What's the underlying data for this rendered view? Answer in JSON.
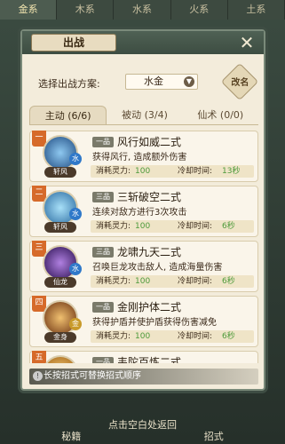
{
  "background_tabs": [
    "金系",
    "木系",
    "水系",
    "火系",
    "土系"
  ],
  "modal": {
    "title": "出战",
    "close_label": "✕",
    "scheme_label": "选择出战方案:",
    "scheme_value": "水金",
    "edit_label": "改名"
  },
  "tabs": [
    {
      "label": "主动 (6/6)"
    },
    {
      "label": "被动 (3/4)"
    },
    {
      "label": "仙术 (0/0)"
    }
  ],
  "skills": [
    {
      "num": "一",
      "level": "一品",
      "name": "风行如威二式",
      "desc": "获得风行, 造成额外伤害",
      "cost_label": "消耗灵力:",
      "cost": "100",
      "cd_label": "冷却时间:",
      "cd": "13秒",
      "avatar_name": "轩风",
      "elem": "水",
      "avatar_color": "#3a78b8"
    },
    {
      "num": "二",
      "level": "三品",
      "name": "三斩破空二式",
      "desc": "连续对敌方进行3次攻击",
      "cost_label": "消耗灵力:",
      "cost": "100",
      "cd_label": "冷却时间:",
      "cd": "6秒",
      "avatar_name": "轩风",
      "elem": "水",
      "avatar_color": "#4a8fc8"
    },
    {
      "num": "三",
      "level": "三品",
      "name": "龙啸九天二式",
      "desc": "召唤巨龙攻击敌人, 造成海量伤害",
      "cost_label": "消耗灵力:",
      "cost": "100",
      "cd_label": "冷却时间:",
      "cd": "6秒",
      "avatar_name": "仙龙",
      "elem": "水",
      "avatar_color": "#5a3a8a"
    },
    {
      "num": "四",
      "level": "一品",
      "name": "金刚护体二式",
      "desc": "获得护盾并使护盾获得伤害减免",
      "cost_label": "消耗灵力:",
      "cost": "100",
      "cd_label": "冷却时间:",
      "cd": "6秒",
      "avatar_name": "金身",
      "elem": "金",
      "avatar_color": "#8a5a2a"
    },
    {
      "num": "五",
      "level": "一品",
      "name": "韦陀百炼二式",
      "desc": "",
      "cost_label": "",
      "cost": "",
      "cd_label": "",
      "cd": "",
      "avatar_name": "",
      "elem": "",
      "avatar_color": "#c88a2a"
    }
  ],
  "hint": "长按招式可替换招式顺序",
  "back_text": "点击空白处返回",
  "bottom_tabs": [
    "秘籍",
    "招式"
  ]
}
